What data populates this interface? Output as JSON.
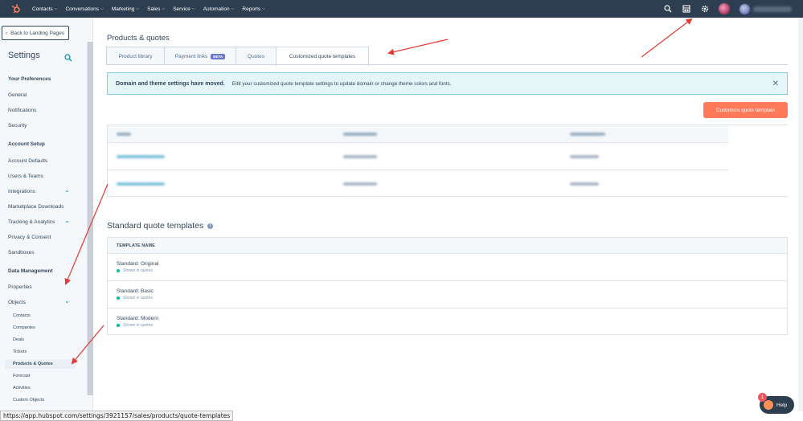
{
  "topnav": {
    "items": [
      {
        "label": "Contacts"
      },
      {
        "label": "Conversations"
      },
      {
        "label": "Marketing"
      },
      {
        "label": "Sales"
      },
      {
        "label": "Service"
      },
      {
        "label": "Automation"
      },
      {
        "label": "Reports"
      }
    ],
    "icons": [
      "search-icon",
      "marketplace-icon",
      "gear-icon"
    ]
  },
  "sidebar": {
    "back_label": "Back to Landing Pages",
    "title": "Settings",
    "sections": [
      {
        "heading": "Your Preferences",
        "items": [
          "General",
          "Notifications",
          "Security"
        ]
      },
      {
        "heading": "Account Setup",
        "items": [
          "Account Defaults",
          "Users & Teams",
          "Integrations",
          "Marketplace Downloads",
          "Tracking & Analytics",
          "Privacy & Consent",
          "Sandboxes"
        ]
      },
      {
        "heading": "Data Management",
        "items": [
          "Properties",
          "Objects"
        ]
      }
    ],
    "object_items": [
      "Contacts",
      "Companies",
      "Deals",
      "Tickets",
      "Products & Quotes",
      "Forecast",
      "Activities",
      "Custom Objects"
    ],
    "active_item": "Products & Quotes"
  },
  "main": {
    "page_title": "Products & quotes",
    "tabs": [
      {
        "label": "Product library"
      },
      {
        "label": "Payment links",
        "badge": "BETA"
      },
      {
        "label": "Quotes"
      },
      {
        "label": "Customized quote templates",
        "active": true
      }
    ],
    "alert": {
      "title": "Domain and theme settings have moved.",
      "text": "Edit your customized quote template settings to update domain or change theme colors and fonts."
    },
    "cta_label": "Customize quote template",
    "standard": {
      "title": "Standard quote templates",
      "column_header": "TEMPLATE NAME",
      "rows": [
        {
          "name": "Standard: Original",
          "status": "Shown in quotes"
        },
        {
          "name": "Standard: Basic",
          "status": "Shown in quotes"
        },
        {
          "name": "Standard: Modern",
          "status": "Shown in quotes"
        }
      ]
    }
  },
  "help": {
    "label": "Help",
    "badge_count": "1"
  },
  "statusbar": {
    "url": "https://app.hubspot.com/settings/3921157/sales/products/quote-templates"
  },
  "colors": {
    "nav_bg": "#2d3e50",
    "accent": "#ff7a59",
    "link": "#0091ae",
    "annotation": "#e53935"
  }
}
